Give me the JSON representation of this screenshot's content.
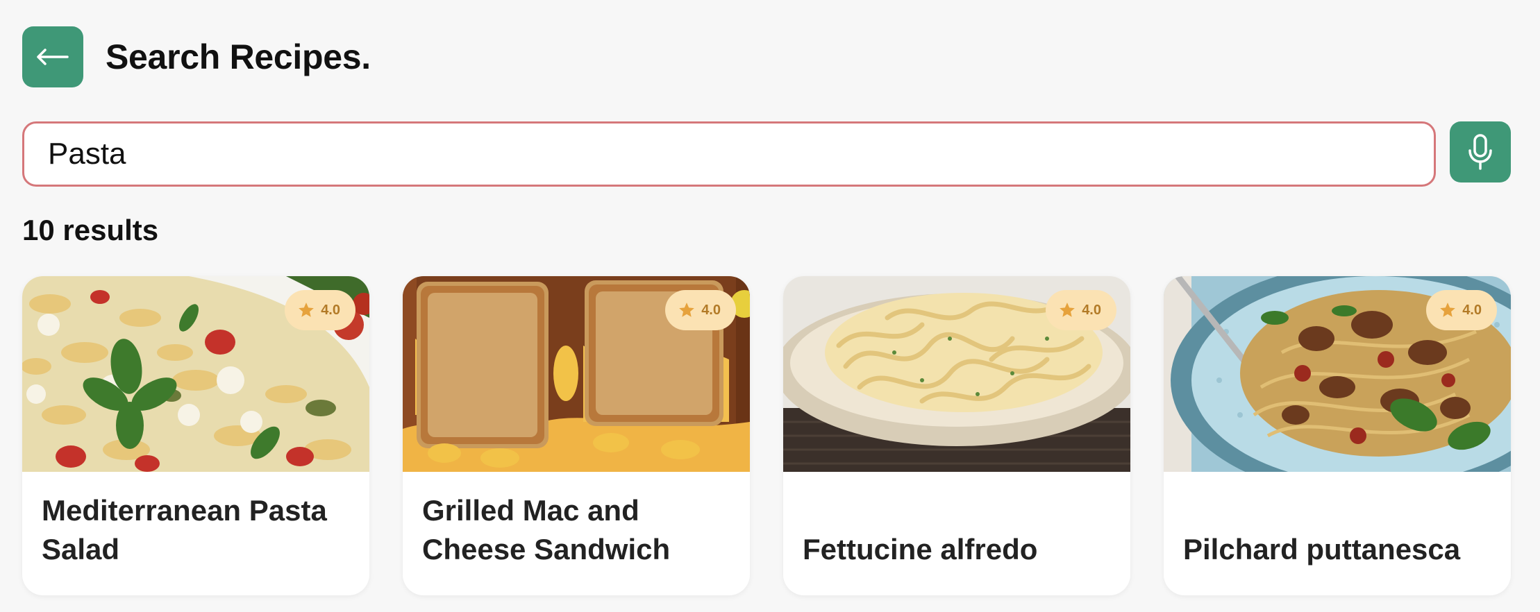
{
  "header": {
    "back_icon": "arrow-left-icon",
    "title": "Search Recipes."
  },
  "search": {
    "value": "Pasta",
    "placeholder": "",
    "mic_icon": "microphone-icon"
  },
  "results": {
    "count_label": "10 results"
  },
  "cards": [
    {
      "title": "Mediterranean Pasta Salad",
      "rating": "4.0",
      "image": "pasta-salad-photo"
    },
    {
      "title": "Grilled Mac and Cheese Sandwich",
      "rating": "4.0",
      "image": "grilled-mac-cheese-photo"
    },
    {
      "title": "Fettucine alfredo",
      "rating": "4.0",
      "image": "fettucine-alfredo-photo"
    },
    {
      "title": "Pilchard puttanesca",
      "rating": "4.0",
      "image": "pilchard-puttanesca-photo"
    }
  ],
  "colors": {
    "accent": "#3f9877",
    "search_border": "#d5777a",
    "rating_badge_bg": "#fbe2b3",
    "rating_star": "#e6a23c"
  }
}
